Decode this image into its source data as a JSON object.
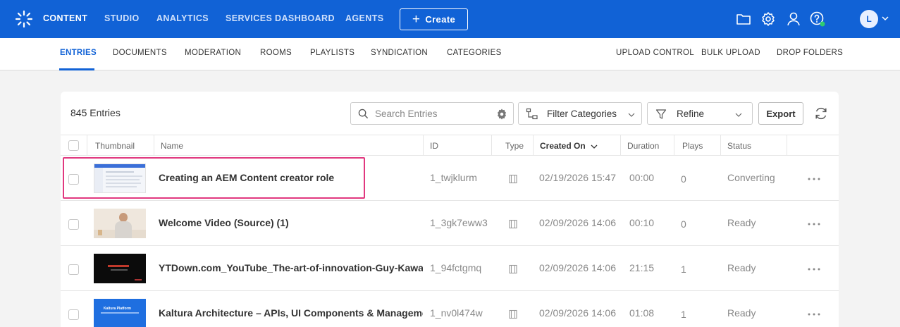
{
  "topnav": {
    "items": [
      "CONTENT",
      "STUDIO",
      "ANALYTICS",
      "SERVICES DASHBOARD",
      "AGENTS"
    ],
    "create_label": "Create",
    "avatar_letter": "L"
  },
  "subnav": {
    "left": [
      "ENTRIES",
      "DOCUMENTS",
      "MODERATION",
      "ROOMS",
      "PLAYLISTS",
      "SYNDICATION",
      "CATEGORIES"
    ],
    "right": [
      "UPLOAD CONTROL",
      "BULK UPLOAD",
      "DROP FOLDERS"
    ]
  },
  "toolbar": {
    "entries_count": "845 Entries",
    "search_placeholder": "Search Entries",
    "filter_categories": "Filter Categories",
    "refine": "Refine",
    "export": "Export"
  },
  "table": {
    "headers": {
      "thumbnail": "Thumbnail",
      "name": "Name",
      "id": "ID",
      "type": "Type",
      "created_on": "Created On",
      "duration": "Duration",
      "plays": "Plays",
      "status": "Status"
    },
    "rows": [
      {
        "name": "Creating an AEM Content creator role",
        "id": "1_twjklurm",
        "created": "02/19/2026 15:47",
        "duration": "00:00",
        "plays": "0",
        "status": "Converting"
      },
      {
        "name": "Welcome Video (Source) (1)",
        "id": "1_3gk7eww3",
        "created": "02/09/2026 14:06",
        "duration": "00:10",
        "plays": "0",
        "status": "Ready"
      },
      {
        "name": "YTDown.com_YouTube_The-art-of-innovation-Guy-Kawas...",
        "id": "1_94fctgmq",
        "created": "02/09/2026 14:06",
        "duration": "21:15",
        "plays": "1",
        "status": "Ready"
      },
      {
        "name": "Kaltura Architecture – APIs, UI Components & Manageme...",
        "id": "1_nv0l474w",
        "created": "02/09/2026 14:06",
        "duration": "01:08",
        "plays": "1",
        "status": "Ready"
      }
    ]
  },
  "thumb_text": {
    "kaltura": "Kaltura Platform"
  },
  "colors": {
    "brand_blue": "#1162d6",
    "highlight": "#e1387f",
    "status_online": "#2ecc71"
  }
}
